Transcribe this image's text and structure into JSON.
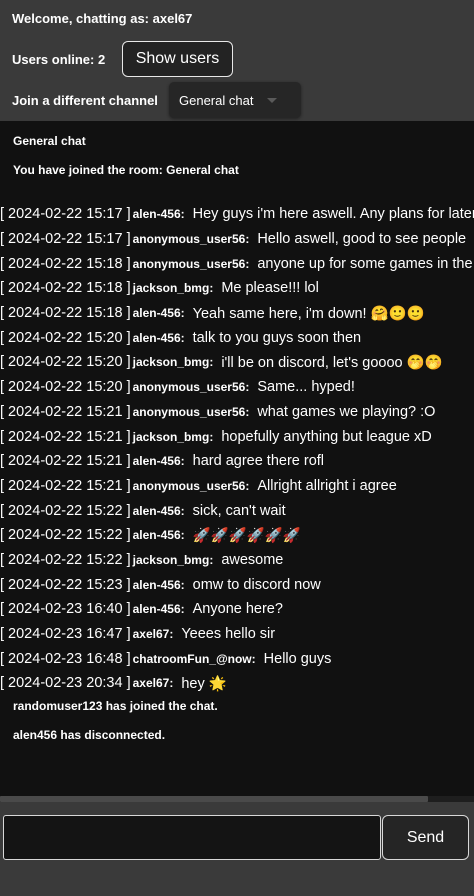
{
  "header": {
    "welcome": "Welcome, chatting as: axel67",
    "users_online": "Users online: 2",
    "show_users_label": "Show users",
    "channel_label": "Join a different channel",
    "channel_selected": "General chat"
  },
  "chat": {
    "title": "General chat",
    "joined_note": "You have joined the room: General chat",
    "messages": [
      {
        "timestamp": "[ 2024-02-22 15:17 ]",
        "user": "alen-456",
        "text": "Hey guys i'm here aswell. Any plans for later?"
      },
      {
        "timestamp": "[ 2024-02-22 15:17 ]",
        "user": "anonymous_user56",
        "text": "Hello aswell, good to see people"
      },
      {
        "timestamp": "[ 2024-02-22 15:18 ]",
        "user": "anonymous_user56",
        "text": "anyone up for some games in the"
      },
      {
        "timestamp": "[ 2024-02-22 15:18 ]",
        "user": "jackson_bmg",
        "text": "Me please!!! lol"
      },
      {
        "timestamp": "[ 2024-02-22 15:18 ]",
        "user": "alen-456",
        "text": "Yeah same here, i'm down! 🤗🙂🙂"
      },
      {
        "timestamp": "[ 2024-02-22 15:20 ]",
        "user": "alen-456",
        "text": "talk to you guys soon then"
      },
      {
        "timestamp": "[ 2024-02-22 15:20 ]",
        "user": "jackson_bmg",
        "text": "i'll be on discord, let's goooo 🤭🤭"
      },
      {
        "timestamp": "[ 2024-02-22 15:20 ]",
        "user": "anonymous_user56",
        "text": "Same... hyped!"
      },
      {
        "timestamp": "[ 2024-02-22 15:21 ]",
        "user": "anonymous_user56",
        "text": "what games we playing? :O"
      },
      {
        "timestamp": "[ 2024-02-22 15:21 ]",
        "user": "jackson_bmg",
        "text": "hopefully anything but league xD"
      },
      {
        "timestamp": "[ 2024-02-22 15:21 ]",
        "user": "alen-456",
        "text": "hard agree there rofl"
      },
      {
        "timestamp": "[ 2024-02-22 15:21 ]",
        "user": "anonymous_user56",
        "text": "Allright allright i agree"
      },
      {
        "timestamp": "[ 2024-02-22 15:22 ]",
        "user": "alen-456",
        "text": "sick, can't wait"
      },
      {
        "timestamp": "[ 2024-02-22 15:22 ]",
        "user": "alen-456",
        "text": "🚀🚀🚀🚀🚀🚀"
      },
      {
        "timestamp": "[ 2024-02-22 15:22 ]",
        "user": "jackson_bmg",
        "text": "awesome"
      },
      {
        "timestamp": "[ 2024-02-22 15:23 ]",
        "user": "alen-456",
        "text": "omw to discord now"
      },
      {
        "timestamp": "[ 2024-02-23 16:40 ]",
        "user": "alen-456",
        "text": "Anyone here?"
      },
      {
        "timestamp": "[ 2024-02-23 16:47 ]",
        "user": "axel67",
        "text": "Yeees hello sir"
      },
      {
        "timestamp": "[ 2024-02-23 16:48 ]",
        "user": "chatroomFun_@now",
        "text": "Hello guys"
      },
      {
        "timestamp": "[ 2024-02-23 20:34 ]",
        "user": "axel67",
        "text": "hey 🌟"
      }
    ],
    "system_notes": [
      "randomuser123 has joined the chat.",
      "alen456 has disconnected."
    ]
  },
  "composer": {
    "input_value": "",
    "send_label": "Send"
  }
}
